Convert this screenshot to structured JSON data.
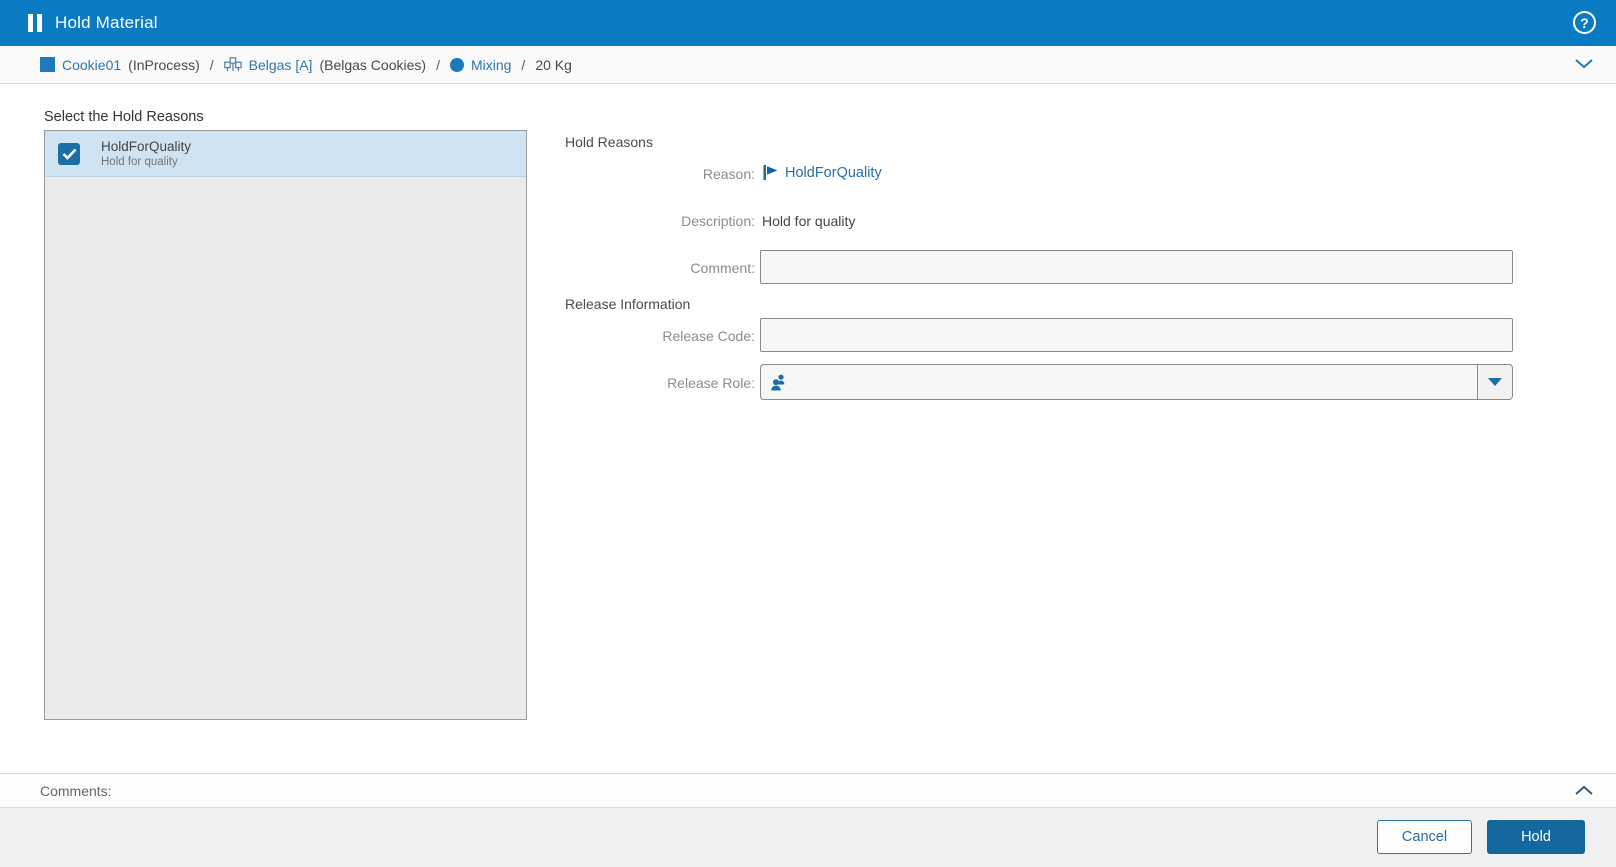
{
  "header": {
    "title": "Hold Material",
    "help_icon_glyph": "?"
  },
  "breadcrumb": {
    "separator": "/",
    "items": [
      {
        "icon": "material-icon",
        "label": "Cookie01",
        "status": "(InProcess)"
      },
      {
        "icon": "equipment-icon",
        "label": "Belgas [A]",
        "status": "(Belgas Cookies)"
      },
      {
        "icon": "operation-icon",
        "label": "Mixing",
        "status": ""
      },
      {
        "icon": "",
        "label": "20 Kg",
        "status": ""
      }
    ]
  },
  "left_panel": {
    "title": "Select the Hold Reasons",
    "items": [
      {
        "name": "HoldForQuality",
        "description": "Hold for quality",
        "checked": true,
        "selected": true
      }
    ]
  },
  "details": {
    "section_hold_reasons": "Hold Reasons",
    "reason": {
      "label": "Reason:",
      "value": "HoldForQuality"
    },
    "description": {
      "label": "Description:",
      "value": "Hold for quality"
    },
    "comment": {
      "label": "Comment:",
      "value": ""
    },
    "section_release": "Release Information",
    "release_code": {
      "label": "Release Code:",
      "value": ""
    },
    "release_role": {
      "label": "Release Role:",
      "value": ""
    }
  },
  "comments_bar": {
    "label": "Comments:"
  },
  "footer": {
    "cancel_label": "Cancel",
    "hold_label": "Hold"
  },
  "colors": {
    "header_blue": "#0a7bc3",
    "link_blue": "#2e78ad",
    "accent_blue": "#1b6fa5",
    "primary_button_blue": "#15689e",
    "selected_row_bg": "#cfe3f2",
    "list_bg": "#ebebeb",
    "footer_bg": "#f0f0f0"
  }
}
